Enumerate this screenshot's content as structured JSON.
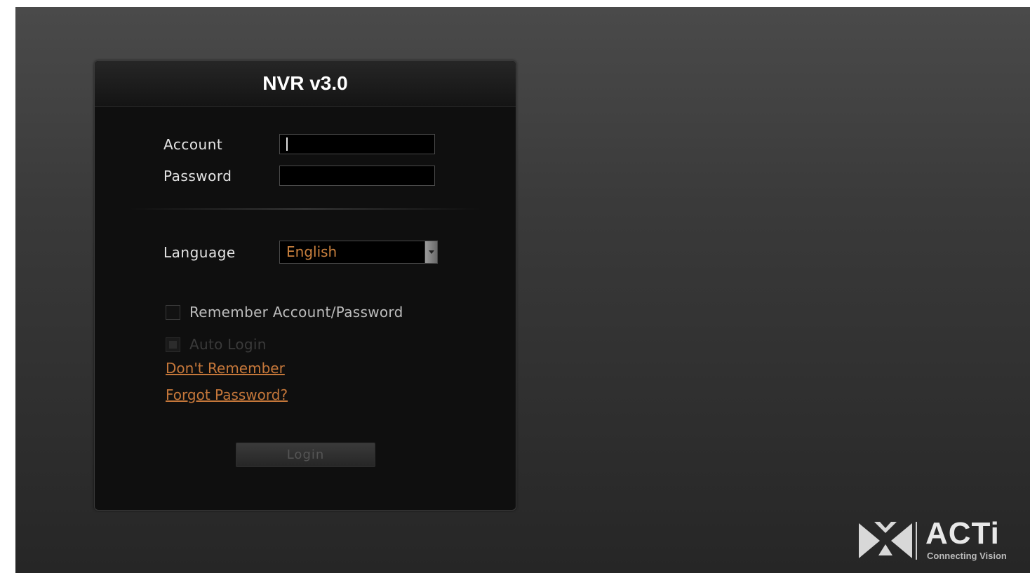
{
  "header": {
    "title": "NVR v3.0"
  },
  "form": {
    "account_label": "Account",
    "account_value": "",
    "password_label": "Password",
    "password_value": "",
    "language_label": "Language",
    "language_selected": "English",
    "remember_label": "Remember Account/Password",
    "remember_checked": false,
    "autologin_label": "Auto Login",
    "autologin_enabled": false,
    "dont_remember_link": "Don't Remember",
    "forgot_password_link": "Forgot Password?",
    "login_label": "Login"
  },
  "brand": {
    "name": "ACTi",
    "tagline": "Connecting Vision",
    "logo_icon": "acti-bowtie-icon"
  },
  "colors": {
    "accent": "#c5773a",
    "panel_bg": "#0f0f0f",
    "label_text": "#e4e4e4"
  }
}
